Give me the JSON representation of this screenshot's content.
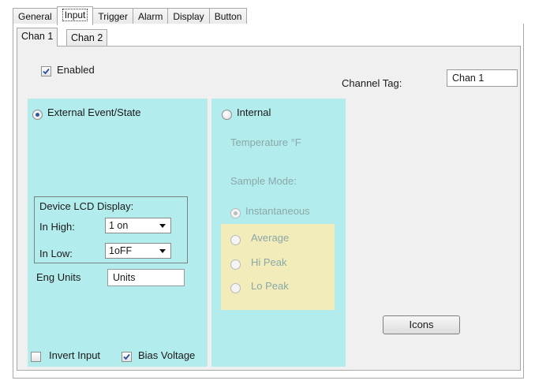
{
  "tabs": [
    {
      "label": "General"
    },
    {
      "label": "Input",
      "active": true
    },
    {
      "label": "Trigger"
    },
    {
      "label": "Alarm"
    },
    {
      "label": "Display"
    },
    {
      "label": "Button"
    }
  ],
  "subtabs": [
    {
      "label": "Chan 1",
      "active": true
    },
    {
      "label": "Chan 2"
    }
  ],
  "enabled": {
    "label": "Enabled",
    "checked": true
  },
  "channel_tag": {
    "label": "Channel Tag:",
    "value": "Chan 1"
  },
  "external": {
    "radio_label": "External Event/State",
    "selected": true,
    "lcd_group": {
      "title": "Device LCD Display:",
      "in_high_label": "In High:",
      "in_high_value": "1 on",
      "in_low_label": "In Low:",
      "in_low_value": "1oFF"
    },
    "eng_units_label": "Eng Units",
    "eng_units_value": "Units",
    "invert_input": {
      "label": "Invert Input",
      "checked": false
    },
    "bias_voltage": {
      "label": "Bias Voltage",
      "checked": true
    }
  },
  "internal": {
    "radio_label": "Internal",
    "selected": false,
    "temperature_label": "Temperature °F",
    "sample_mode_label": "Sample Mode:",
    "modes": [
      {
        "label": "Instantaneous",
        "selected": true
      },
      {
        "label": "Average",
        "selected": false
      },
      {
        "label": "Hi Peak",
        "selected": false
      },
      {
        "label": "Lo Peak",
        "selected": false
      }
    ]
  },
  "icons_button": {
    "label": "Icons"
  },
  "colors": {
    "cyan_panel": "#b3ecec",
    "yellow_panel": "#f1ecb9",
    "disabled_text": "#8aa8a8",
    "panel_bg": "#f0f0f0"
  }
}
